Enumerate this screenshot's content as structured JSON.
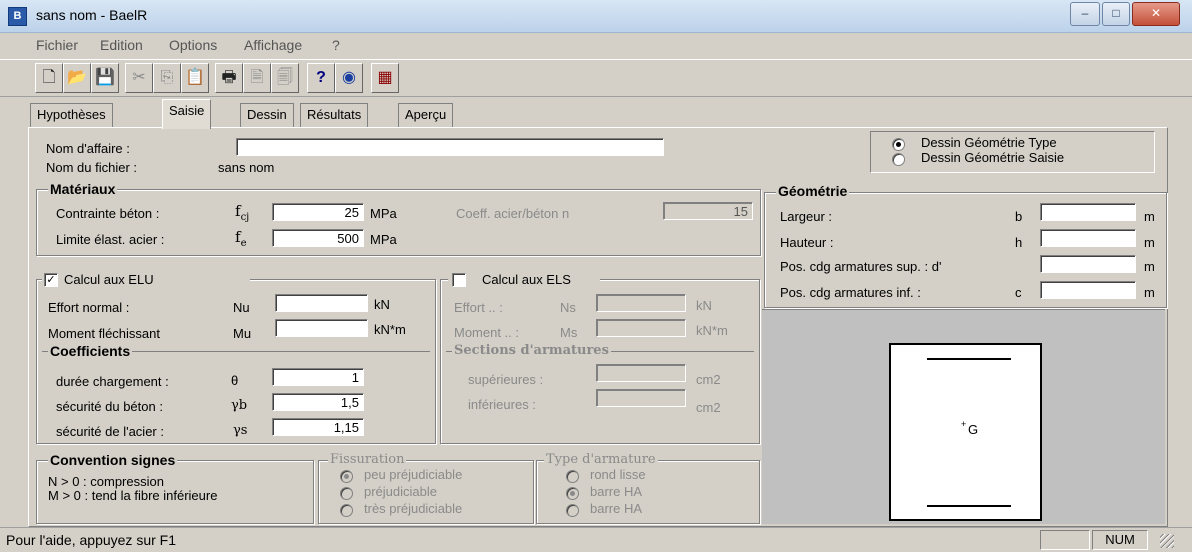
{
  "window": {
    "title": "sans nom - BaelR",
    "app_icon": "B"
  },
  "controls": {
    "minimize": "‒",
    "maximize": "□",
    "close": "✕"
  },
  "menu": [
    "Fichier",
    "Edition",
    "Options",
    "Affichage",
    "?"
  ],
  "toolbar": [
    {
      "icon": "new-icon",
      "glyph": "🗋"
    },
    {
      "icon": "open-icon",
      "glyph": "📂"
    },
    {
      "icon": "save-icon",
      "glyph": "💾"
    },
    {
      "icon": "cut-icon",
      "glyph": "✂"
    },
    {
      "icon": "copy-icon",
      "glyph": "⎘"
    },
    {
      "icon": "paste-icon",
      "glyph": "📋"
    },
    {
      "icon": "print-icon",
      "glyph": "🖶"
    },
    {
      "icon": "print-preview-icon",
      "glyph": "🗎"
    },
    {
      "icon": "print-setup-icon",
      "glyph": "🗐"
    },
    {
      "icon": "help-icon",
      "glyph": "?"
    },
    {
      "icon": "context-help-icon",
      "glyph": "◉"
    },
    {
      "icon": "calculator-icon",
      "glyph": "▦"
    }
  ],
  "tabs": [
    "Hypothèses",
    "Saisie",
    "Dessin",
    "Résultats",
    "Aperçu"
  ],
  "top": {
    "nom_affaire_label": "Nom d'affaire :",
    "nom_affaire_value": "",
    "nom_fichier_label": "Nom du fichier :",
    "nom_fichier_value": "sans nom",
    "radio_type": "Dessin Géométrie Type",
    "radio_saisie": "Dessin Géométrie Saisie"
  },
  "materiaux": {
    "title": "Matériaux",
    "contrainte_label": "Contrainte béton :",
    "contrainte_symbol": "f",
    "contrainte_sub": "cj",
    "contrainte_value": "25",
    "contrainte_unit": "MPa",
    "limite_label": "Limite élast. acier :",
    "limite_symbol": "f",
    "limite_sub": "e",
    "limite_value": "500",
    "limite_unit": "MPa",
    "coeff_label": "Coeff. acier/béton  n",
    "coeff_value": "15"
  },
  "geometrie": {
    "title": "Géométrie",
    "rows": [
      {
        "label": "Largeur :",
        "sym": "b",
        "unit": "m"
      },
      {
        "label": "Hauteur :",
        "sym": "h",
        "unit": "m"
      },
      {
        "label": "Pos. cdg armatures sup. : d'",
        "sym": "",
        "unit": "m"
      },
      {
        "label": "Pos. cdg armatures inf. :",
        "sym": "c",
        "unit": "m"
      }
    ]
  },
  "elu": {
    "title": "Calcul aux ELU",
    "checked": "✓",
    "effort_label": "Effort normal :",
    "effort_sym": "Nu",
    "effort_unit": "kN",
    "moment_label": "Moment fléchissant",
    "moment_sym": "Mu",
    "moment_unit": "kN*m"
  },
  "coefficients": {
    "title": "Coefficients",
    "duree_label": "durée chargement :",
    "duree_sym": "θ",
    "duree_value": "1",
    "beton_label": "sécurité du béton :",
    "beton_sym": "γb",
    "beton_value": "1,5",
    "acier_label": "sécurité de l'acier :",
    "acier_sym": "γs",
    "acier_value": "1,15"
  },
  "els": {
    "title": "Calcul aux ELS",
    "effort_label": "Effort .. :",
    "effort_sym": "Ns",
    "effort_unit": "kN",
    "moment_label": "Moment .. :",
    "moment_sym": "Ms",
    "moment_unit": "kN*m"
  },
  "sections": {
    "title": "Sections d'armatures",
    "sup_label": "supérieures :",
    "inf_label": "inférieures :",
    "unit": "cm2"
  },
  "convention": {
    "title": "Convention signes",
    "line1": "N > 0 : compression",
    "line2": "M > 0 : tend la fibre inférieure"
  },
  "fissuration": {
    "title": "Fissuration",
    "options": [
      "peu préjudiciable",
      "préjudiciable",
      "très préjudiciable"
    ],
    "selected": 0
  },
  "type_armature": {
    "title": "Type d'armature",
    "options": [
      "rond lisse",
      "barre HA",
      "barre HA"
    ],
    "selected": 1
  },
  "preview": {
    "centroid_label": "G"
  },
  "status": {
    "help": "Pour l'aide, appuyez sur F1",
    "num": "NUM"
  }
}
